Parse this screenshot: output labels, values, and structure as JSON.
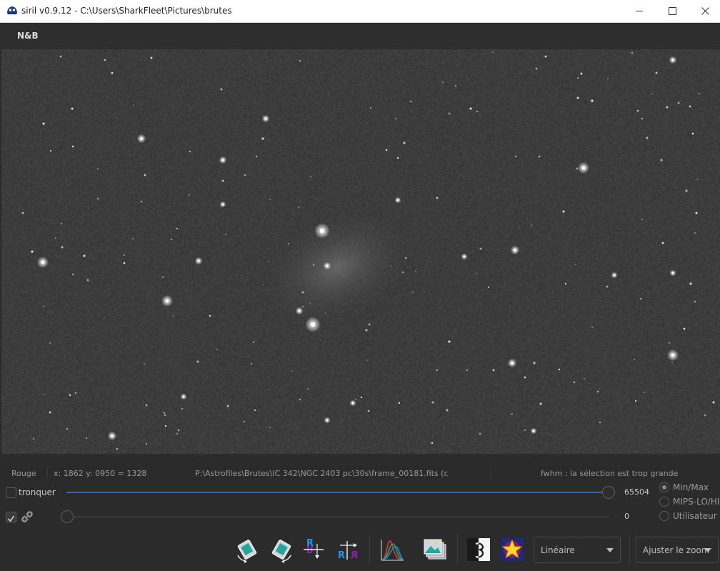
{
  "window": {
    "title": "siril v0.9.12 - C:\\Users\\SharkFleet\\Pictures\\brutes",
    "minimize_icon": "minimize-icon",
    "maximize_icon": "maximize-icon",
    "close_icon": "close-icon"
  },
  "tabs": [
    {
      "label": "N&B",
      "active": true
    }
  ],
  "status": {
    "channel": "Rouge",
    "coords": "x: 1862 y: 0950 = 1328",
    "filepath": "P:\\Astrofiles\\Brutes\\IC 342\\NGC 2403 pc\\30s\\frame_00181.fits (c",
    "fwhm": "fwhm : la sélection est trop grande"
  },
  "controls": {
    "clip_label": "tronquer",
    "clip_checked": false,
    "link_checked": true,
    "high_value": "65504",
    "low_value": "0",
    "high_level_fraction": 1.0,
    "low_level_fraction": 0.0,
    "scaling_options": [
      {
        "label": "Min/Max",
        "selected": true
      },
      {
        "label": "MIPS-LO/HI",
        "selected": false
      },
      {
        "label": "Utilisateur",
        "selected": false
      }
    ]
  },
  "toolbar": {
    "buttons": [
      {
        "name": "rotate-left-button",
        "icon": "rotate-left-icon"
      },
      {
        "name": "rotate-right-button",
        "icon": "rotate-right-icon"
      },
      {
        "name": "mirror-x-button",
        "icon": "mirror-x-icon"
      },
      {
        "name": "mirror-y-button",
        "icon": "mirror-y-icon"
      },
      {
        "name": "histogram-button",
        "icon": "histogram-icon"
      },
      {
        "name": "image-stack-button",
        "icon": "image-stack-icon"
      },
      {
        "name": "negative-view-button",
        "icon": "negative-icon"
      },
      {
        "name": "false-color-button",
        "icon": "false-color-star-icon"
      }
    ],
    "display_mode": "Linéaire",
    "zoom_mode": "Ajuster le zoom"
  },
  "colors": {
    "accent": "#2e6ab1",
    "background": "#2b2b2b",
    "image_bg": "#3b3b3b"
  }
}
